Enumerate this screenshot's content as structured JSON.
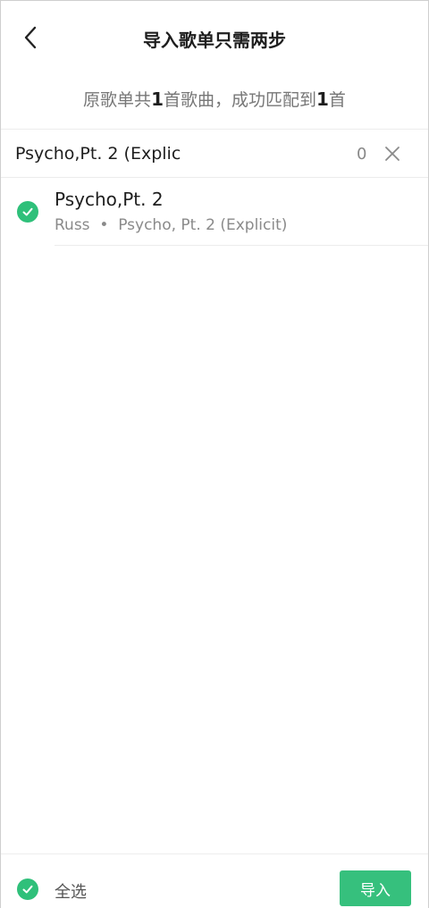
{
  "header": {
    "title": "导入歌单只需两步",
    "back_icon": "chevron-left-icon"
  },
  "summary": {
    "prefix": "原歌单共",
    "total": "1",
    "middle": "首歌曲，成功匹配到",
    "matched": "1",
    "suffix": "首"
  },
  "query": {
    "text": "Psycho,Pt. 2 (Explic",
    "count": "0",
    "clear_icon": "close-icon"
  },
  "songs": [
    {
      "title": "Psycho,Pt. 2",
      "artist": "Russ",
      "separator": "•",
      "album": "Psycho, Pt. 2 (Explicit)",
      "selected": true
    }
  ],
  "footer": {
    "select_all_label": "全选",
    "import_label": "导入"
  },
  "colors": {
    "accent": "#2fc07a",
    "button": "#36c07d"
  }
}
